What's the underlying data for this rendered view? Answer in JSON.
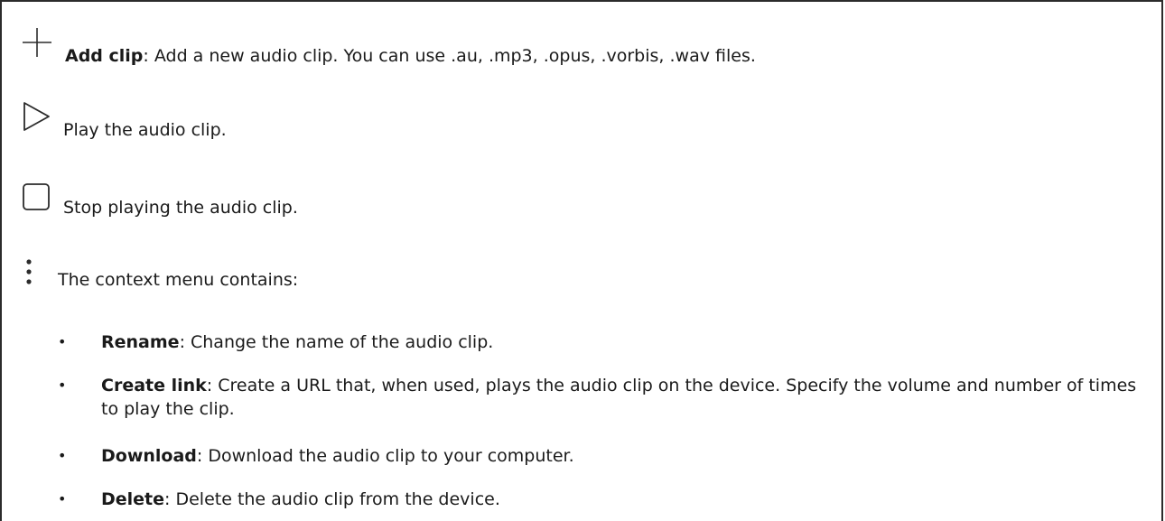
{
  "items": {
    "add": {
      "term": "Add clip",
      "description": ": Add a new audio clip. You can use .au, .mp3, .opus, .vorbis, .wav files.",
      "icon": "plus-icon"
    },
    "play": {
      "description": "Play the audio clip.",
      "icon": "play-icon"
    },
    "stop": {
      "description": "Stop playing the audio clip.",
      "icon": "stop-icon"
    },
    "context": {
      "description": "The context menu contains:",
      "icon": "more-vertical-icon"
    }
  },
  "menu": [
    {
      "term": "Rename",
      "description": ": Change the name of the audio clip."
    },
    {
      "term": "Create link",
      "description": ": Create a URL that, when used, plays the audio clip on the device. Specify the volume and number of times to play the clip."
    },
    {
      "term": "Download",
      "description": ": Download the audio clip to your computer."
    },
    {
      "term": "Delete",
      "description": ": Delete the audio clip from the device."
    }
  ],
  "bullet": "•"
}
